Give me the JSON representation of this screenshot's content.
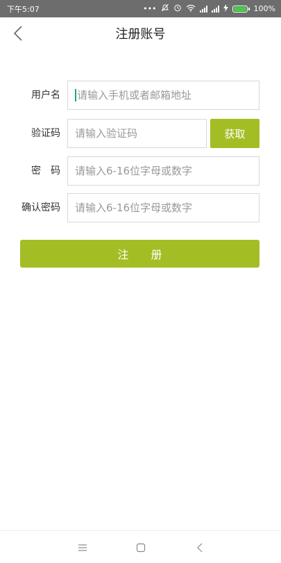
{
  "status_bar": {
    "time": "下午5:07",
    "dots": "•••",
    "battery_text": "100%",
    "battery_level": 1.0,
    "battery_color": "#3dd13d",
    "icons": [
      "mute-icon",
      "alarm-icon",
      "wifi-icon",
      "signal-icon",
      "signal-icon",
      "charging-icon",
      "battery-icon"
    ]
  },
  "header": {
    "title": "注册账号",
    "back_icon": "chevron-left-icon"
  },
  "form": {
    "username": {
      "label": "用户名",
      "placeholder": "请输入手机或者邮箱地址"
    },
    "code": {
      "label": "验证码",
      "placeholder": "请输入验证码",
      "button": "获取"
    },
    "password": {
      "label": "密　码",
      "placeholder": "请输入6-16位字母或数字"
    },
    "confirm": {
      "label": "确认密码",
      "placeholder": "请输入6-16位字母或数字"
    },
    "submit": "注　　册"
  },
  "colors": {
    "accent": "#a3bd24",
    "status_bar": "#6d6d6d",
    "caret": "#1aa38a"
  },
  "nav_bar": {
    "icons": [
      "menu-icon",
      "home-icon",
      "back-icon"
    ]
  }
}
